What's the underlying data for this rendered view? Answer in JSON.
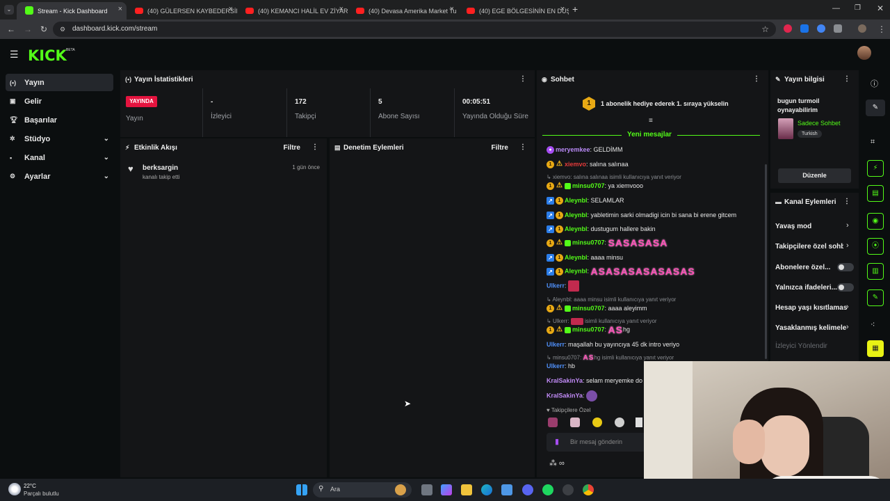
{
  "browser": {
    "tabs": [
      {
        "title": "Stream - Kick Dashboard",
        "favicon": "kick-icon"
      },
      {
        "title": "(40) GÜLERSEN KAYBEDERSİN v",
        "favicon": "youtube-icon"
      },
      {
        "title": "(40) KEMANCI HALİL EV ZİYARE",
        "favicon": "youtube-icon"
      },
      {
        "title": "(40) Devasa Amerika Market Tu",
        "favicon": "youtube-icon"
      },
      {
        "title": "(40) EGE BÖLGESİNİN EN DÜŞÜ",
        "favicon": "youtube-icon"
      }
    ],
    "url": "dashboard.kick.com/stream"
  },
  "header": {
    "logo": "KICK",
    "beta": "BETA"
  },
  "sidebar": {
    "items": [
      {
        "label": "Yayın",
        "icon": "broadcast-icon"
      },
      {
        "label": "Gelir",
        "icon": "revenue-icon"
      },
      {
        "label": "Başarılar",
        "icon": "trophy-icon"
      },
      {
        "label": "Stüdyo",
        "icon": "gear-icon"
      },
      {
        "label": "Kanal",
        "icon": "user-icon"
      },
      {
        "label": "Ayarlar",
        "icon": "gear-icon"
      }
    ]
  },
  "stats": {
    "title": "Yayın İstatistikleri",
    "live_badge": "YAYINDA",
    "items": [
      {
        "value": "",
        "label": "Yayın"
      },
      {
        "value": "-",
        "label": "İzleyici"
      },
      {
        "value": "172",
        "label": "Takipçi"
      },
      {
        "value": "5",
        "label": "Abone Sayısı"
      },
      {
        "value": "00:05:51",
        "label": "Yayında Olduğu Süre"
      }
    ]
  },
  "activity": {
    "title": "Etkinlik Akışı",
    "filter": "Filtre",
    "events": [
      {
        "user": "berksargin",
        "text": "kanalı takip etti",
        "time": "1 gün önce"
      }
    ]
  },
  "moderation": {
    "title": "Denetim Eylemleri",
    "filter": "Filtre"
  },
  "chat": {
    "title": "Sohbet",
    "pinned": "1 abonelik hediye ederek 1. sıraya yükselin",
    "pinned_rank": "1",
    "new_messages": "Yeni mesajlar",
    "followers_only": "Takipçilere Özel",
    "input_placeholder": "Bir mesaj gönderin",
    "messages": [
      {
        "user": "meryemkee",
        "text": ": GELDİMM",
        "color": "#b889f5"
      },
      {
        "user": "xiemvo",
        "text": ": salına salınaa",
        "color": "#e53b3b"
      },
      {
        "reply": "xiemvo: salına salınaa isimli kullanıcıya yanıt veriyor"
      },
      {
        "user": "minsu0707",
        "text": ": ya xiemvooo",
        "color": "#53fc18"
      },
      {
        "user": "Aleynbl",
        "text": ": SELAMLAR",
        "color": "#53fc18"
      },
      {
        "user": "Aleynbl",
        "text": ": yabletimin sarki olmadigi icin bi sana bi erene gitcem",
        "color": "#53fc18"
      },
      {
        "user": "Aleynbl",
        "text": ": dustugum hallere bakin",
        "color": "#53fc18"
      },
      {
        "user": "minsu0707",
        "text": ":",
        "emote": "SASASASA",
        "color": "#53fc18"
      },
      {
        "user": "Aleynbl",
        "text": ": aaaa minsu",
        "color": "#53fc18"
      },
      {
        "user": "Aleynbl",
        "text": ":",
        "emote": "ASASASASASASAS",
        "color": "#53fc18"
      },
      {
        "user": "Ulkerr",
        "text": ":",
        "color": "#4e8ef7"
      },
      {
        "reply": "Aleynbl: aaaa minsu isimli kullanıcıya yanıt veriyor"
      },
      {
        "user": "minsu0707",
        "text": ": aaaa aleyimm",
        "color": "#53fc18"
      },
      {
        "reply": "Ulkerr:",
        "reply_rest": "isimli kullanıcıya yanıt veriyor"
      },
      {
        "user": "minsu0707",
        "text": "hg",
        "emote": "AS",
        "color": "#53fc18"
      },
      {
        "user": "Ulkerr",
        "text": ": maşallah bu yayıncıya 45 dk intro veriyo",
        "color": "#4e8ef7"
      },
      {
        "reply": "minsu0707:",
        "reply_rest": "hg isimli kullanıcıya yanıt veriyor",
        "emote": "AS"
      },
      {
        "user": "Ulkerr",
        "text": ": hb",
        "color": "#4e8ef7"
      },
      {
        "user": "KralSakinYa",
        "text": ": selam meryemke do",
        "color": "#c08af5"
      },
      {
        "user": "KralSakinYa",
        "text": ":",
        "color": "#c08af5"
      }
    ]
  },
  "stream_info": {
    "title": "Yayın bilgisi",
    "stream_title": "bugun turmoil oynayabilirim",
    "category": "Sadece Sohbet",
    "language": "Turkish",
    "edit_button": "Düzenle"
  },
  "channel_actions": {
    "title": "Kanal Eylemleri",
    "items": [
      {
        "label": "Yavaş mod",
        "control": "chevron"
      },
      {
        "label": "Takipçilere özel sohbe",
        "control": "chevron"
      },
      {
        "label": "Abonelere özel...",
        "control": "toggle"
      },
      {
        "label": "Yalnızca ifadeleri...",
        "control": "toggle"
      },
      {
        "label": "Hesap yaşı kısıtlamas",
        "control": "chevron"
      },
      {
        "label": "Yasaklanmış kelimele",
        "control": "chevron"
      },
      {
        "label": "İzleyici Yönlendir",
        "control": "none"
      }
    ]
  },
  "taskbar": {
    "weather_temp": "22°C",
    "weather_desc": "Parçalı bulutlu",
    "search": "Ara"
  },
  "colors": {
    "accent": "#53fc18",
    "live": "#e5143f",
    "background": "#0b0e0f",
    "panel": "#141517"
  }
}
